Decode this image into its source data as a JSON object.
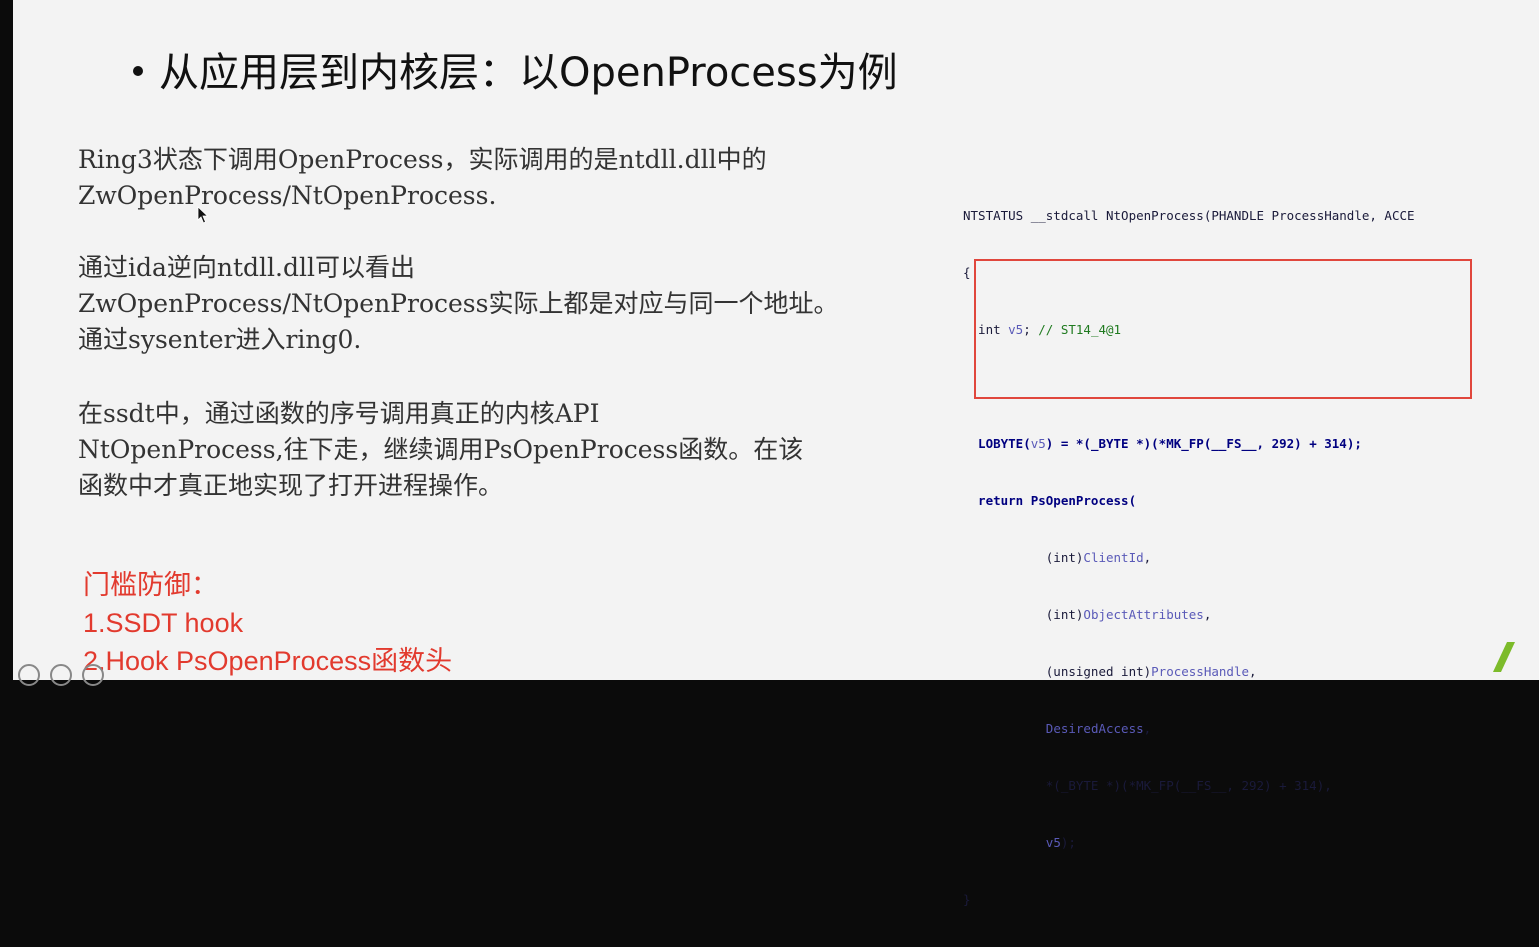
{
  "title": "从应用层到内核层：以OpenProcess为例",
  "paragraph1": [
    "Ring3状态下调用OpenProcess，实际调用的是ntdll.dll中的",
    "ZwOpenProcess/NtOpenProcess."
  ],
  "paragraph2": [
    "通过ida逆向ntdll.dll可以看出",
    "ZwOpenProcess/NtOpenProcess实际上都是对应与同一个地址。",
    "通过sysenter进入ring0."
  ],
  "paragraph3": [
    "在ssdt中，通过函数的序号调用真正的内核API",
    "NtOpenProcess,往下走，继续调用PsOpenProcess函数。在该",
    "函数中才真正地实现了打开进程操作。"
  ],
  "defense": {
    "heading": "门槛防御：",
    "items": [
      "1.SSDT hook",
      "2.Hook PsOpenProcess函数头"
    ]
  },
  "code": {
    "l1a": "NTSTATUS __stdcall NtOpenProcess(PHANDLE ProcessHandle, ACCE",
    "l2": "{",
    "l3a": "  int ",
    "l3b": "v5",
    "l3c": "; ",
    "l3d": "// ST14_4@1",
    "l5a": "  LOBYTE(",
    "l5b": "v5",
    "l5c": ") = *(_BYTE *)(*MK_FP(__FS__, 292) + 314);",
    "l6a": "  return PsOpenProcess(",
    "l7a": "           (int)",
    "l7b": "ClientId",
    "l7c": ",",
    "l8a": "           (int)",
    "l8b": "ObjectAttributes",
    "l8c": ",",
    "l9a": "           (unsigned int)",
    "l9b": "ProcessHandle",
    "l9c": ",",
    "l10b": "DesiredAccess",
    "l10c": ",",
    "l11a": "           *(_BYTE *)(*MK_FP(__FS__, 292) + 314),",
    "l12b": "v5",
    "l12c": ");",
    "l13": "}"
  },
  "colors": {
    "defense_text": "#e23a2e",
    "highlight_box": "#e0463c"
  }
}
